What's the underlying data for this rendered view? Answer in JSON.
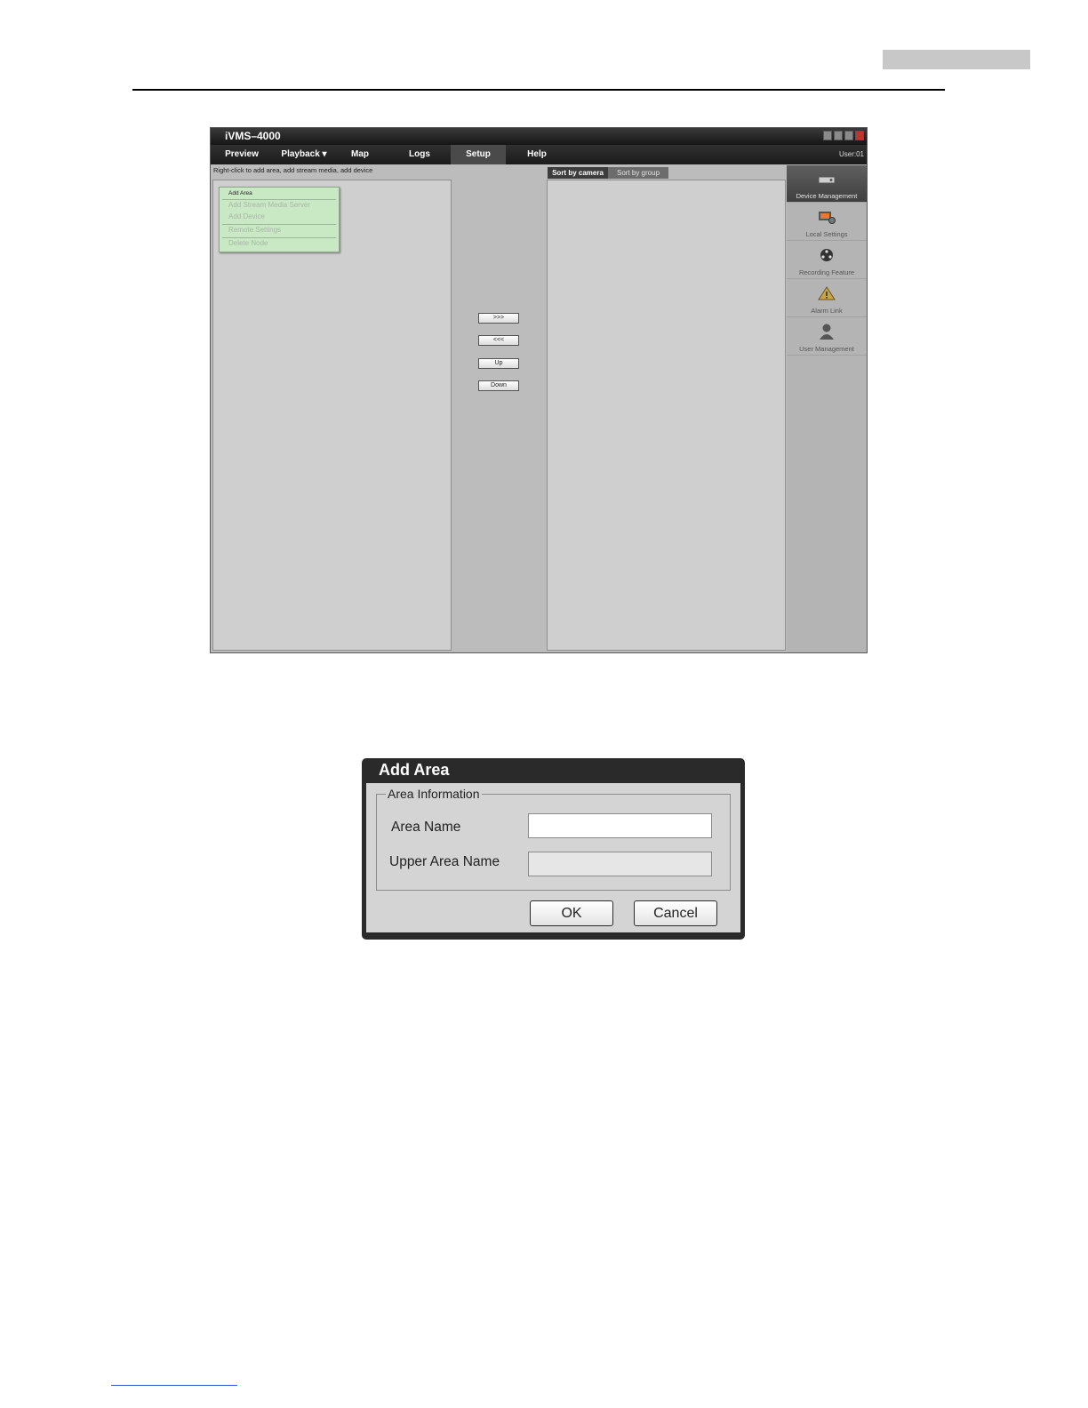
{
  "app": {
    "title": "iVMS–4000",
    "menu": [
      "Preview",
      "Playback ▾",
      "Map",
      "Logs",
      "Setup",
      "Help"
    ],
    "active_menu": "Setup",
    "user": "User:01",
    "hint": "Right-click to add area, add stream media, add device",
    "context_menu": [
      "Add Area",
      "Add Stream Media Server",
      "Add Device",
      "Remote Settings",
      "Delete Node"
    ],
    "mid_buttons": [
      ">>>",
      "<<<",
      "Up",
      "Down"
    ],
    "tabs": [
      "Sort by camera",
      "Sort by group"
    ],
    "sidebar": [
      {
        "label": "Device Management",
        "icon": "device-icon"
      },
      {
        "label": "Local Settings",
        "icon": "local-settings-icon"
      },
      {
        "label": "Recording Feature",
        "icon": "recording-icon"
      },
      {
        "label": "Alarm Link",
        "icon": "alarm-icon"
      },
      {
        "label": "User Management",
        "icon": "user-icon"
      }
    ]
  },
  "dialog": {
    "title": "Add Area",
    "group": "Area Information",
    "area_name_label": "Area Name",
    "upper_area_name_label": "Upper Area Name",
    "area_name_value": "",
    "upper_area_name_value": "",
    "ok": "OK",
    "cancel": "Cancel"
  }
}
